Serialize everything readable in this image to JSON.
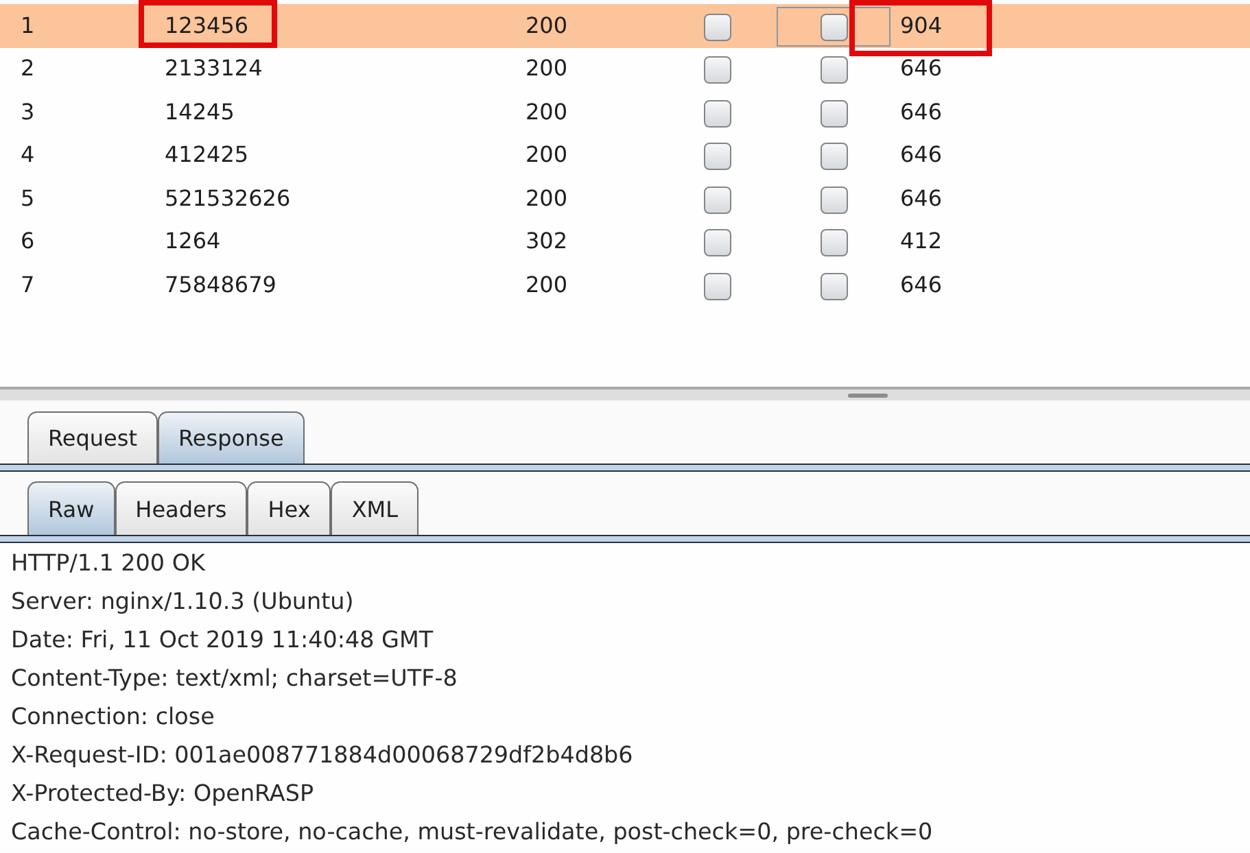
{
  "results_table": {
    "rows": [
      {
        "number": "1",
        "payload": "123456",
        "status": "200",
        "checks": [
          {
            "checked": false,
            "focused": false
          },
          {
            "checked": false,
            "focused": true
          }
        ],
        "length": "904",
        "selected": true,
        "payload_marked": true,
        "length_marked": true
      },
      {
        "number": "2",
        "payload": "2133124",
        "status": "200",
        "checks": [
          {
            "checked": false,
            "focused": false
          },
          {
            "checked": false,
            "focused": false
          }
        ],
        "length": "646",
        "selected": false,
        "payload_marked": false,
        "length_marked": false
      },
      {
        "number": "3",
        "payload": "14245",
        "status": "200",
        "checks": [
          {
            "checked": false,
            "focused": false
          },
          {
            "checked": false,
            "focused": false
          }
        ],
        "length": "646",
        "selected": false,
        "payload_marked": false,
        "length_marked": false
      },
      {
        "number": "4",
        "payload": "412425",
        "status": "200",
        "checks": [
          {
            "checked": false,
            "focused": false
          },
          {
            "checked": false,
            "focused": false
          }
        ],
        "length": "646",
        "selected": false,
        "payload_marked": false,
        "length_marked": false
      },
      {
        "number": "5",
        "payload": "521532626",
        "status": "200",
        "checks": [
          {
            "checked": false,
            "focused": false
          },
          {
            "checked": false,
            "focused": false
          }
        ],
        "length": "646",
        "selected": false,
        "payload_marked": false,
        "length_marked": false
      },
      {
        "number": "6",
        "payload": "1264",
        "status": "302",
        "checks": [
          {
            "checked": false,
            "focused": false
          },
          {
            "checked": false,
            "focused": false
          }
        ],
        "length": "412",
        "selected": false,
        "payload_marked": false,
        "length_marked": false
      },
      {
        "number": "7",
        "payload": "75848679",
        "status": "200",
        "checks": [
          {
            "checked": false,
            "focused": false
          },
          {
            "checked": false,
            "focused": false
          }
        ],
        "length": "646",
        "selected": false,
        "payload_marked": false,
        "length_marked": false
      }
    ]
  },
  "message_tabs": [
    {
      "label": "Request",
      "selected": false
    },
    {
      "label": "Response",
      "selected": true
    }
  ],
  "view_tabs": [
    {
      "label": "Raw",
      "selected": true
    },
    {
      "label": "Headers",
      "selected": false
    },
    {
      "label": "Hex",
      "selected": false
    },
    {
      "label": "XML",
      "selected": false
    }
  ],
  "response_lines": [
    "HTTP/1.1 200 OK",
    "Server: nginx/1.10.3 (Ubuntu)",
    "Date: Fri, 11 Oct 2019 11:40:48 GMT",
    "Content-Type: text/xml; charset=UTF-8",
    "Connection: close",
    "X-Request-ID: 001ae008771884d00068729df2b4d8b6",
    "X-Protected-By: OpenRASP",
    "Cache-Control: no-store, no-cache, must-revalidate, post-check=0, pre-check=0"
  ]
}
